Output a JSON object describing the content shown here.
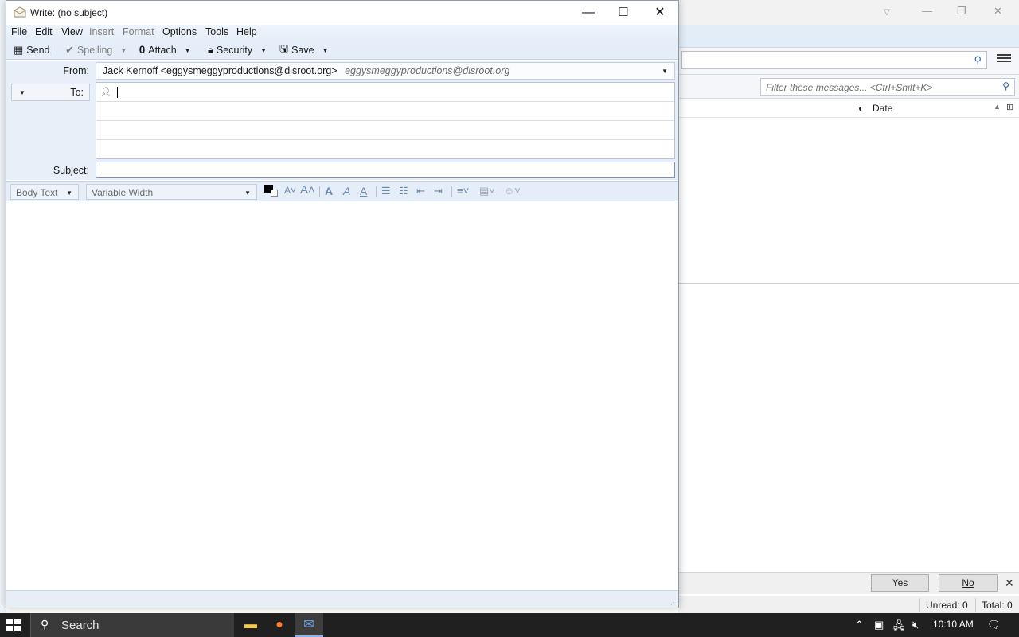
{
  "background_window": {
    "filter_placeholder": "Filter these messages... <Ctrl+Shift+K>",
    "column_date": "Date",
    "notification": {
      "yes_label": "Yes",
      "no_label": "No"
    },
    "status": {
      "unread": "Unread: 0",
      "total": "Total: 0"
    }
  },
  "compose": {
    "title": "Write: (no subject)",
    "menu": [
      "File",
      "Edit",
      "View",
      "Insert",
      "Format",
      "Options",
      "Tools",
      "Help"
    ],
    "menu_disabled": [
      "Insert",
      "Format"
    ],
    "toolbar": {
      "send": "Send",
      "spelling": "Spelling",
      "attach": "Attach",
      "security": "Security",
      "save": "Save"
    },
    "from_label": "From:",
    "from_value": "Jack Kernoff <eggysmeggyproductions@disroot.org>",
    "from_alias": "eggysmeggyproductions@disroot.org",
    "to_label": "To:",
    "to_value": "",
    "subject_label": "Subject:",
    "subject_value": "",
    "format": {
      "paragraph_style": "Body Text",
      "font": "Variable Width"
    }
  },
  "taskbar": {
    "search_label": "Search",
    "clock": "10:10 AM"
  },
  "colors": {
    "accent": "#2b5ea8",
    "toolbar_bg": "#e5eef8",
    "taskbar_bg": "#202020"
  }
}
